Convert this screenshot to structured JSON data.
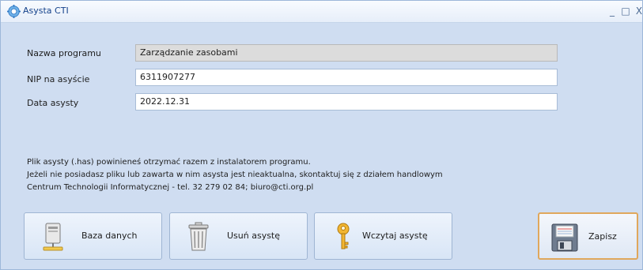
{
  "window": {
    "title": "Asysta CTI",
    "minimize": "_",
    "maximize": "□",
    "close": "X"
  },
  "form": {
    "program_label": "Nazwa programu",
    "program_value": "Zarządzanie zasobami",
    "nip_label": "NIP na asyście",
    "nip_value": "6311907277",
    "date_label": "Data asysty",
    "date_value": "2022.12.31"
  },
  "info": {
    "line1": "Plik asysty (.has) powinieneś otrzymać razem z instalatorem programu.",
    "line2": "Jeżeli nie posiadasz pliku lub zawarta w nim asysta jest nieaktualna, skontaktuj się z działem handlowym",
    "line3": "Centrum Technologii Informatycznej - tel. 32 279 02 84; biuro@cti.org.pl"
  },
  "buttons": {
    "database": "Baza danych",
    "remove": "Usuń asystę",
    "load": "Wczytaj asystę",
    "save": "Zapisz"
  },
  "icons": {
    "app": "gear-icon",
    "database": "computer-tower-icon",
    "remove": "trash-icon",
    "load": "key-icon",
    "save": "floppy-disk-icon"
  },
  "colors": {
    "window_bg": "#cfddf1",
    "title_text": "#15428b",
    "primary_border": "#e0a75c"
  }
}
